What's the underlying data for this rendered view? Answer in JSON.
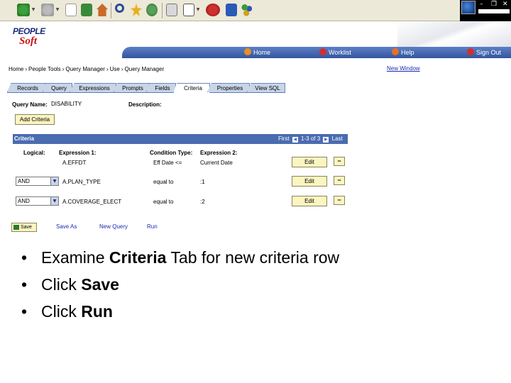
{
  "browser_toolbar": {
    "icons": [
      "back-icon",
      "forward-icon",
      "stop-icon",
      "refresh-icon",
      "home-icon",
      "search-icon",
      "favorites-icon",
      "history-icon",
      "print-icon",
      "word-icon",
      "app-icon",
      "ie-icon",
      "messenger-icon"
    ]
  },
  "window_controls": {
    "minimize": "–",
    "restore": "❐",
    "close": "✕"
  },
  "brand": {
    "top": "PEOPLE",
    "bottom": "Soft"
  },
  "navbar": {
    "home": "Home",
    "worklist": "Worklist",
    "help": "Help",
    "signout": "Sign Out"
  },
  "breadcrumb": [
    "Home",
    "People Tools",
    "Query Manager",
    "Use",
    "Query Manager"
  ],
  "breadcrumb_separator": "›",
  "new_window": "New Window",
  "tabs": [
    "Records",
    "Query",
    "Expressions",
    "Prompts",
    "Fields",
    "Criteria",
    "Properties",
    "View SQL"
  ],
  "active_tab": "Criteria",
  "query": {
    "name_label": "Query Name:",
    "name_value": "DISABILITY",
    "description_label": "Description:",
    "add_criteria": "Add Criteria"
  },
  "criteria": {
    "title": "Criteria",
    "nav_first": "First",
    "nav_range": "1-3 of 3",
    "nav_last": "Last",
    "prev_glyph": "◀",
    "next_glyph": "▶",
    "columns": {
      "logical": "Logical:",
      "expression1": "Expression 1:",
      "condition": "Condition Type:",
      "expression2": "Expression 2:"
    },
    "rows": [
      {
        "logical": "",
        "expression1": "A.EFFDT",
        "condition": "Eff Date <=",
        "expression2": "Current Date",
        "edit": "Edit",
        "delete": "−"
      },
      {
        "logical": "AND",
        "expression1": "A.PLAN_TYPE",
        "condition": "equal to",
        "expression2": ":1",
        "edit": "Edit",
        "delete": "−"
      },
      {
        "logical": "AND",
        "expression1": "A.COVERAGE_ELECT",
        "condition": "equal to",
        "expression2": ":2",
        "edit": "Edit",
        "delete": "−"
      }
    ],
    "dropdown_glyph": "▼"
  },
  "bottom_actions": {
    "save": "Save",
    "save_as": "Save As",
    "new_query": "New Query",
    "run": "Run"
  },
  "bullets": [
    {
      "dot": "•",
      "prefix": "Examine ",
      "bold": "Criteria",
      "suffix": " Tab for new criteria row"
    },
    {
      "dot": "•",
      "prefix": "Click ",
      "bold": "Save",
      "suffix": ""
    },
    {
      "dot": "•",
      "prefix": "Click ",
      "bold": "Run",
      "suffix": ""
    }
  ],
  "colors": {
    "grid_header": "#4a6cb0",
    "navbar": "#4466b0",
    "button_fill": "#fbf5c0",
    "link": "#1a2ab0"
  }
}
